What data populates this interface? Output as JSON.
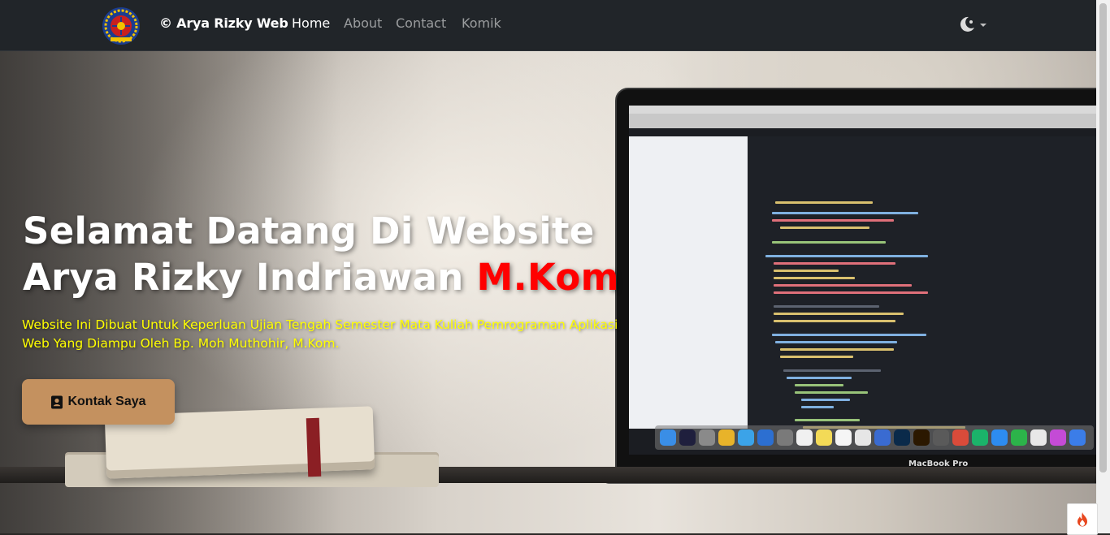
{
  "navbar": {
    "brand": "© Arya Rizky Web",
    "links": [
      {
        "label": "Home",
        "active": true
      },
      {
        "label": "About",
        "active": false
      },
      {
        "label": "Contact",
        "active": false
      },
      {
        "label": "Komik",
        "active": false
      }
    ],
    "theme_toggle_icon": "moon-sun-icon",
    "theme_toggle_caret": "caret-down-icon"
  },
  "hero": {
    "title_line1": "Selamat Datang Di Website",
    "title_line2": "Arya Rizky Indriawan",
    "title_accent": "M.Kom",
    "subtitle_line1": "Website Ini Dibuat Untuk Keperluan Ujian Tengah Semester Mata Kuliah Pemrograman Aplikasi",
    "subtitle_line2": "Web Yang Diampu Oleh Bp. Moh Muthohir, M.Kom.",
    "button_label": "Kontak Saya",
    "button_icon": "contact-book-icon",
    "laptop_label": "MacBook Pro"
  },
  "colors": {
    "navbar_bg": "#212529",
    "accent_red": "#ff0000",
    "subtitle_yellow": "#ffff00",
    "button_bg": "#c4915f"
  }
}
